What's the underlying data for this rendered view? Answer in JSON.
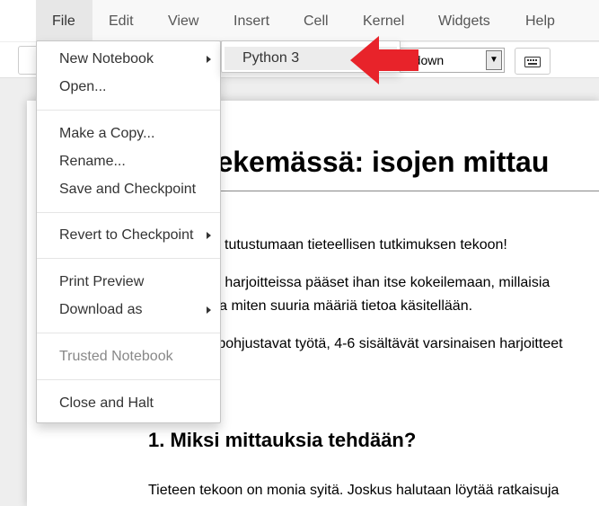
{
  "menubar": {
    "items": [
      "File",
      "Edit",
      "View",
      "Insert",
      "Cell",
      "Kernel",
      "Widgets",
      "Help"
    ],
    "active": "File"
  },
  "toolbar": {
    "cell_type_value": "rkdown",
    "keyboard_icon": "keyboard-icon"
  },
  "file_menu": {
    "items": [
      {
        "label": "New Notebook"
      },
      {
        "label": "Open..."
      },
      {
        "label": "Make a Copy..."
      },
      {
        "label": "Rename..."
      },
      {
        "label": "Save and Checkpoint"
      },
      {
        "label": "Revert to Checkpoint"
      },
      {
        "label": "Print Preview"
      },
      {
        "label": "Download as"
      },
      {
        "label": "Trusted Notebook"
      },
      {
        "label": "Close and Halt"
      }
    ]
  },
  "new_notebook_submenu": {
    "items": [
      {
        "label": "Python 3"
      }
    ]
  },
  "annotation": {
    "color": "#e8232a"
  },
  "notebook": {
    "title": "että tekemässä: isojen mittau",
    "para1": "tutustumaan tieteellisen tutkimuksen tekoon!",
    "para2_line1": "sa harjoitteissa pääset ihan itse kokeilemaan, millaisia",
    "para2_line2": "ii ja miten suuria määriä tietoa käsitellään.",
    "para3": "3 pohjustavat työtä, 4-6 sisältävät varsinaisen harjoitteet",
    "section_heading": "1. Miksi mittauksia tehdään?",
    "para4": "Tieteen tekoon on monia syitä. Joskus halutaan löytää ratkaisuja"
  }
}
